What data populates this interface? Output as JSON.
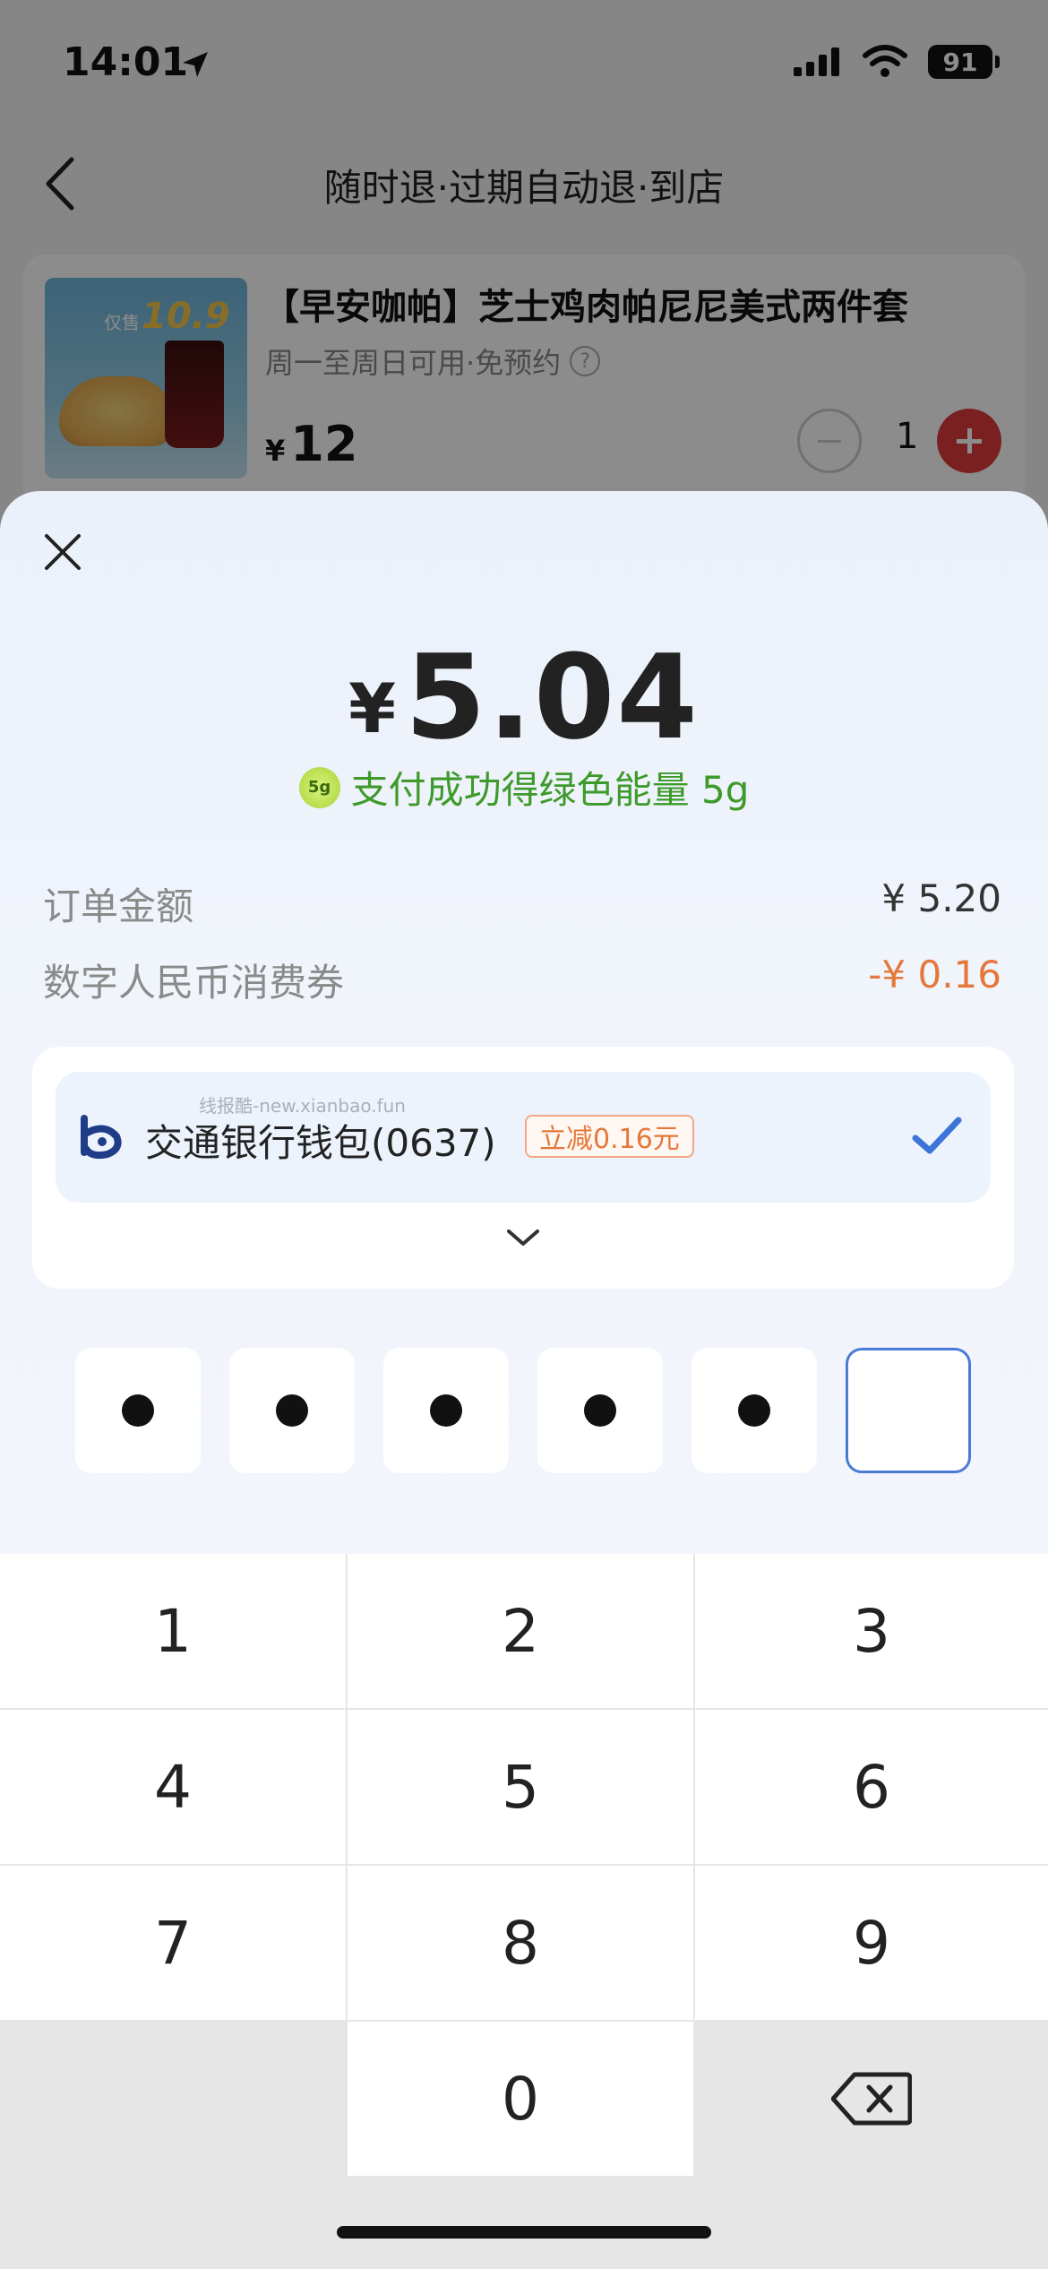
{
  "status_bar": {
    "time": "14:01",
    "battery": "91"
  },
  "nav": {
    "title": "随时退·过期自动退·到店"
  },
  "product": {
    "image_promo_prefix": "仅售",
    "image_promo_price": "10.9",
    "title": "【早安咖帕】芝士鸡肉帕尼尼美式两件套",
    "subtitle": "周一至周日可用·免预约",
    "help_symbol": "?",
    "currency": "¥",
    "price": "12",
    "quantity": "1"
  },
  "payment": {
    "currency": "¥",
    "amount": "5.04",
    "energy_badge": "5g",
    "energy_text": "支付成功得绿色能量 5g",
    "order_label": "订单金额",
    "order_value": "¥ 5.20",
    "coupon_label": "数字人民币消费券",
    "coupon_value": "-¥ 0.16",
    "method": {
      "bank_name": "交通银行钱包(0637)",
      "discount_tag": "立减0.16元",
      "watermark": "线报酷-new.xianbao.fun"
    }
  },
  "pin": {
    "filled_count": 5,
    "total": 6
  },
  "keypad": {
    "keys": [
      "1",
      "2",
      "3",
      "4",
      "5",
      "6",
      "7",
      "8",
      "9",
      "0"
    ]
  },
  "icons": {
    "location_arrow": "location-arrow-icon",
    "signal": "signal-icon",
    "wifi": "wifi-icon",
    "back": "chevron-left-icon",
    "close": "close-icon",
    "check": "checkmark-icon",
    "expand": "chevron-down-icon",
    "backspace": "backspace-icon",
    "bank": "bank-of-communications-icon"
  },
  "colors": {
    "accent_blue": "#4a7bd6",
    "energy_green": "#3e9a2a",
    "discount_orange": "#e4783a",
    "plus_red": "#e03b3b"
  }
}
